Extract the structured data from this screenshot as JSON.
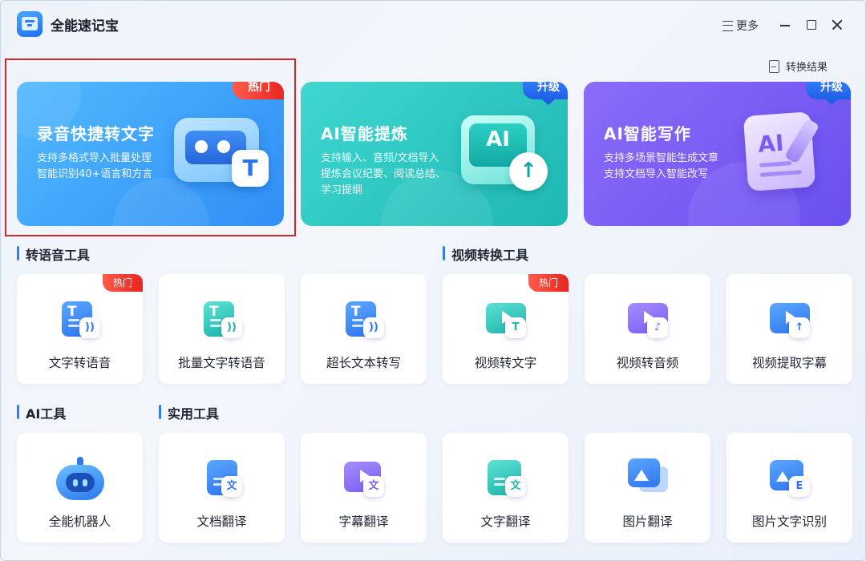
{
  "app": {
    "title": "全能速记宝",
    "more_label": "更多",
    "results_label": "转换结果"
  },
  "colors": {
    "accent": "#2f7ff5",
    "hot": "#e8241e",
    "blue_card": "#2f8ef5",
    "teal_card": "#1fb7b4",
    "violet_card": "#6a4ff0"
  },
  "features": [
    {
      "title": "录音快捷转文字",
      "desc1": "支持多格式导入批量处理",
      "desc2": "智能识别40+语言和方言",
      "desc3": "",
      "tag": "热门"
    },
    {
      "title": "AI智能提炼",
      "desc1": "支持输入、音频/文档导入",
      "desc2": "提炼会议纪要、阅读总结、",
      "desc3": "学习提纲",
      "tag": "升级"
    },
    {
      "title": "AI智能写作",
      "desc1": "支持多场景智能生成文章",
      "desc2": "支持文档导入智能改写",
      "desc3": "",
      "tag": "升级"
    }
  ],
  "sections": {
    "voice": "转语音工具",
    "video": "视频转换工具",
    "ai": "AI工具",
    "utility": "实用工具"
  },
  "tools": {
    "text_to_speech": {
      "label": "文字转语音",
      "tag": "热门",
      "glyph": "T"
    },
    "batch_text_to_speech": {
      "label": "批量文字转语音",
      "glyph": "T"
    },
    "long_text": {
      "label": "超长文本转写",
      "glyph": "T"
    },
    "video_to_text": {
      "label": "视频转文字",
      "tag": "热门",
      "glyph": "T"
    },
    "video_to_audio": {
      "label": "视频转音频",
      "glyph": "♪"
    },
    "video_subtitle": {
      "label": "视频提取字幕",
      "glyph": "↑"
    },
    "robot": {
      "label": "全能机器人"
    },
    "doc_translate": {
      "label": "文档翻译",
      "glyph": "文"
    },
    "subtitle_translate": {
      "label": "字幕翻译",
      "glyph": "文"
    },
    "text_translate": {
      "label": "文字翻译",
      "glyph": "文"
    },
    "image_translate": {
      "label": "图片翻译"
    },
    "image_ocr": {
      "label": "图片文字识别",
      "glyph": "E"
    }
  },
  "art": {
    "t_glyph": "T",
    "ai_glyph": "AI",
    "up_glyph": "↑"
  }
}
